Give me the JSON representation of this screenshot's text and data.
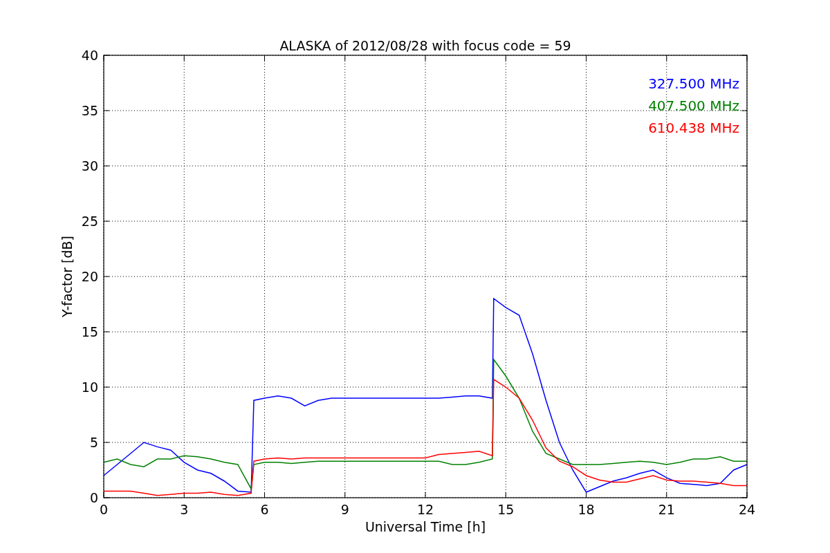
{
  "chart_data": {
    "type": "line",
    "title": "ALASKA of 2012/08/28 with focus code = 59",
    "xlabel": "Universal Time [h]",
    "ylabel": "Y-factor [dB]",
    "x": [
      0,
      0.5,
      1,
      1.5,
      2,
      2.5,
      3,
      3.5,
      4,
      4.5,
      5,
      5.5,
      5.6,
      6,
      6.5,
      7,
      7.5,
      8,
      8.5,
      9,
      9.5,
      10,
      10.5,
      11,
      11.5,
      12,
      12.5,
      13,
      13.5,
      14,
      14.5,
      14.55,
      15,
      15.5,
      16,
      16.5,
      17,
      17.5,
      18,
      18.5,
      19,
      19.5,
      20,
      20.5,
      21,
      21.5,
      22,
      22.5,
      23,
      23.5,
      24
    ],
    "series": [
      {
        "name": "327.500 MHz",
        "color": "#0000ff",
        "values": [
          2,
          3,
          4,
          5,
          4.6,
          4.3,
          3.2,
          2.5,
          2.2,
          1.5,
          0.6,
          0.5,
          8.8,
          9,
          9.2,
          9,
          8.3,
          8.8,
          9,
          9,
          9,
          9,
          9,
          9,
          9,
          9,
          9,
          9.1,
          9.2,
          9.2,
          9,
          18,
          17.2,
          16.5,
          13,
          8.8,
          5,
          2.5,
          0.5,
          1,
          1.5,
          1.8,
          2.2,
          2.5,
          1.8,
          1.3,
          1.2,
          1.1,
          1.3,
          2.5,
          3
        ]
      },
      {
        "name": "407.500 MHz",
        "color": "#008000",
        "values": [
          3.2,
          3.5,
          3,
          2.8,
          3.5,
          3.5,
          3.8,
          3.7,
          3.5,
          3.2,
          3,
          0.8,
          3,
          3.2,
          3.2,
          3.1,
          3.2,
          3.3,
          3.3,
          3.3,
          3.3,
          3.3,
          3.3,
          3.3,
          3.3,
          3.3,
          3.3,
          3,
          3,
          3.2,
          3.5,
          12.5,
          11,
          9,
          6,
          4,
          3.5,
          3,
          3,
          3,
          3.1,
          3.2,
          3.3,
          3.2,
          3,
          3.2,
          3.5,
          3.5,
          3.7,
          3.3,
          3.3
        ]
      },
      {
        "name": "610.438 MHz",
        "color": "#ff0000",
        "values": [
          0.6,
          0.6,
          0.6,
          0.4,
          0.2,
          0.3,
          0.4,
          0.4,
          0.5,
          0.3,
          0.2,
          0.4,
          3.3,
          3.5,
          3.6,
          3.5,
          3.6,
          3.6,
          3.6,
          3.6,
          3.6,
          3.6,
          3.6,
          3.6,
          3.6,
          3.6,
          3.9,
          4,
          4.1,
          4.2,
          3.8,
          10.7,
          10,
          9,
          7,
          4.5,
          3.3,
          2.8,
          2,
          1.6,
          1.4,
          1.4,
          1.7,
          2,
          1.6,
          1.5,
          1.5,
          1.4,
          1.3,
          1.1,
          1.1
        ]
      }
    ],
    "xlim": [
      0,
      24
    ],
    "ylim": [
      0,
      40
    ],
    "xticks": [
      0,
      3,
      6,
      9,
      12,
      15,
      18,
      21,
      24
    ],
    "yticks": [
      0,
      5,
      10,
      15,
      20,
      25,
      30,
      35,
      40
    ],
    "grid": true
  }
}
